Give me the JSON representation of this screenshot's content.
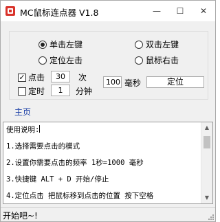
{
  "window": {
    "title": "MC鼠标连点器 V1.8",
    "controls": {
      "minimize": "—",
      "maximize": "☐",
      "close": "✕"
    },
    "accent_color": "#d9332b"
  },
  "click_options": {
    "single_left": {
      "label": "单击左键",
      "selected": true
    },
    "double_left": {
      "label": "双击左键",
      "selected": false
    },
    "locate_left": {
      "label": "定位左击",
      "selected": false
    },
    "mouse_right": {
      "label": "鼠标右击",
      "selected": false
    }
  },
  "click_count": {
    "label": "点击",
    "checked": true,
    "check_mark": "✓",
    "value": "30",
    "unit": "次"
  },
  "timer": {
    "label": "定时",
    "checked": false,
    "value": "1",
    "unit": "分钟"
  },
  "interval": {
    "value": "100",
    "unit": "毫秒"
  },
  "locate_button": {
    "label": "定位"
  },
  "home_link": {
    "label": "主页"
  },
  "instructions": {
    "lines": [
      "使用说明:",
      "1.选择需要点击的模式",
      "2.设置你需要点击的频率 1秒=1000 毫秒",
      "3.快捷键 ALT + D 开始/停止",
      "4.定位点击 把鼠标移到点击的位置 按下空格"
    ],
    "scroll_up_icon": "▲",
    "scroll_down_icon": "▼"
  },
  "status": {
    "text": "开始吧~!"
  }
}
